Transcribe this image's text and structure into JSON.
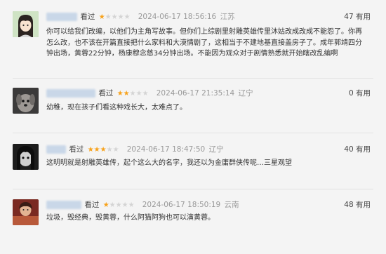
{
  "comments": [
    {
      "status": "看过",
      "rating": 1,
      "time": "2024-06-17 18:56:16",
      "location": "江苏",
      "votes": "47 有用",
      "content": "你可以给我们改编，以他们为主角写故事。但你们上综剧里射雕英雄传里沐姑改成改成不能怨了。你再怎么改，也不该在开篇直接把什么家料和大漠情剧了，这相当于不建地基直接盖房子了。成年郭靖四分钟出场，黄蓉22分钟，杨康穆念慈34分钟出场。不能因为观众对于剧情熟悉就开始瞎改乱编啊",
      "avatar_icon": "anime-portrait-icon"
    },
    {
      "status": "看过",
      "rating": 2,
      "time": "2024-06-17 21:35:14",
      "location": "辽宁",
      "votes": "0 有用",
      "content": "幼稚，现在孩子们看这种戏长大，太难点了。",
      "avatar_icon": "dog-avatar-icon"
    },
    {
      "status": "看过",
      "rating": 3,
      "time": "2024-06-17 18:47:50",
      "location": "辽宁",
      "votes": "40 有用",
      "content": "这明明就是射雕英雄传，起个这么大的名字，我还以为金庸群侠传呢…三星观望",
      "avatar_icon": "dark-portrait-icon"
    },
    {
      "status": "看过",
      "rating": 1,
      "time": "2024-06-17 18:50:19",
      "location": "云南",
      "votes": "48 有用",
      "content": "垃圾，毁经典，毁黄蓉，什么阿猫阿狗也可以演黄蓉。",
      "avatar_icon": "photo-avatar-icon"
    }
  ],
  "colors": {
    "star_on": "#f7a21b",
    "star_off": "#d4d4d4",
    "meta_gray": "#999999",
    "background": "#f4f4f4"
  }
}
